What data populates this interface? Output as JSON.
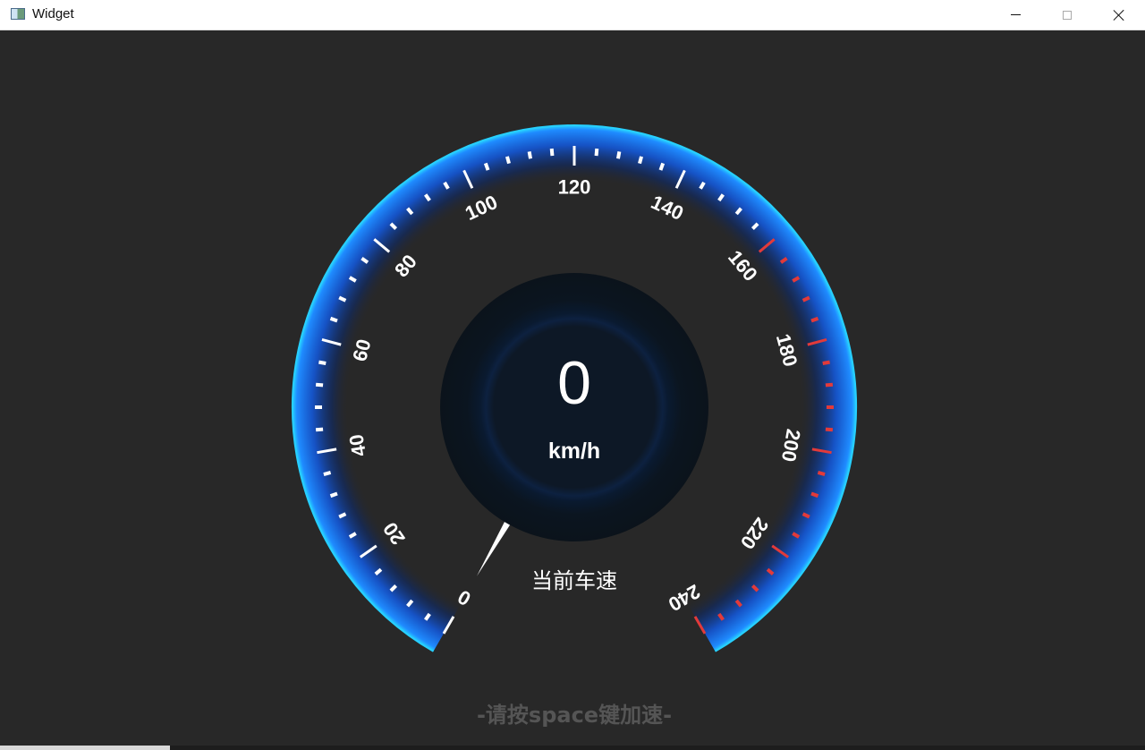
{
  "window": {
    "title": "Widget",
    "icon": "app-window-icon",
    "controls": {
      "minimize_icon": "minimize-icon",
      "maximize_icon": "maximize-icon",
      "close_icon": "close-icon"
    }
  },
  "gauge": {
    "speed_value": "0",
    "unit": "km/h",
    "caption": "当前车速",
    "min": 0,
    "max": 240,
    "major_step": 20,
    "minor_per_major": 5,
    "warning_from": 160,
    "tick_labels": [
      "0",
      "20",
      "40",
      "60",
      "80",
      "100",
      "120",
      "140",
      "160",
      "180",
      "200",
      "220",
      "240"
    ],
    "colors": {
      "background": "#282828",
      "arc_blue": "#1d8bff",
      "arc_edge": "#27d0ff",
      "normal_tick": "#ffffff",
      "warning_tick": "#e23a3a",
      "center_outer": "#0c141c",
      "center_inner": "#0d1a2a",
      "needle": "#ffffff"
    }
  },
  "hint": "-请按space键加速-"
}
